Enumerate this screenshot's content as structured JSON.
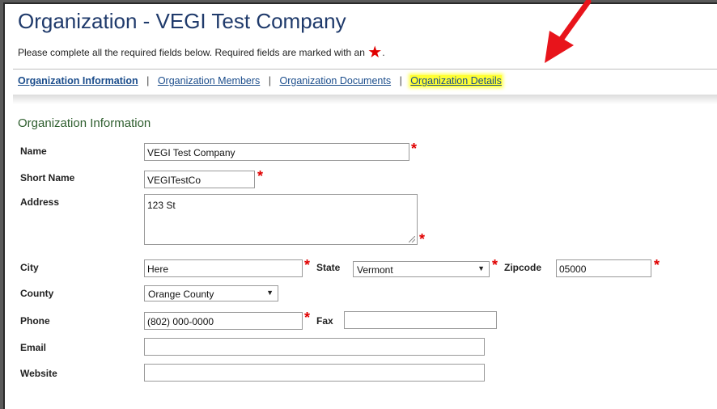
{
  "page": {
    "title": "Organization - VEGI Test Company",
    "instructions": "Please complete all the required fields below. Required fields are marked with an",
    "required_marker": "★",
    "instructions_end": "."
  },
  "tabs": [
    {
      "label": "Organization Information",
      "active": true
    },
    {
      "label": "Organization Members"
    },
    {
      "label": "Organization Documents"
    },
    {
      "label": "Organization Details",
      "highlighted": true
    }
  ],
  "tab_separator": "|",
  "section": {
    "title": "Organization Information"
  },
  "form": {
    "name": {
      "label": "Name",
      "value": "VEGI Test Company"
    },
    "short_name": {
      "label": "Short Name",
      "value": "VEGITestCo"
    },
    "address": {
      "label": "Address",
      "value": "123 St"
    },
    "city": {
      "label": "City",
      "value": "Here"
    },
    "state": {
      "label": "State",
      "value": "Vermont"
    },
    "zipcode": {
      "label": "Zipcode",
      "value": "05000"
    },
    "county": {
      "label": "County",
      "value": "Orange County"
    },
    "phone": {
      "label": "Phone",
      "value": "(802) 000-0000"
    },
    "fax": {
      "label": "Fax",
      "value": ""
    },
    "email": {
      "label": "Email",
      "value": ""
    },
    "website": {
      "label": "Website",
      "value": ""
    }
  },
  "colors": {
    "title": "#1f3a6b",
    "link": "#1a4c8b",
    "required": "#e00000",
    "highlight": "#ffff33",
    "annotation_arrow": "#e8141b"
  },
  "icons": {
    "required": "asterisk-star",
    "dropdown": "triangle-down",
    "annotation": "red-arrow-pointing-down-left"
  }
}
